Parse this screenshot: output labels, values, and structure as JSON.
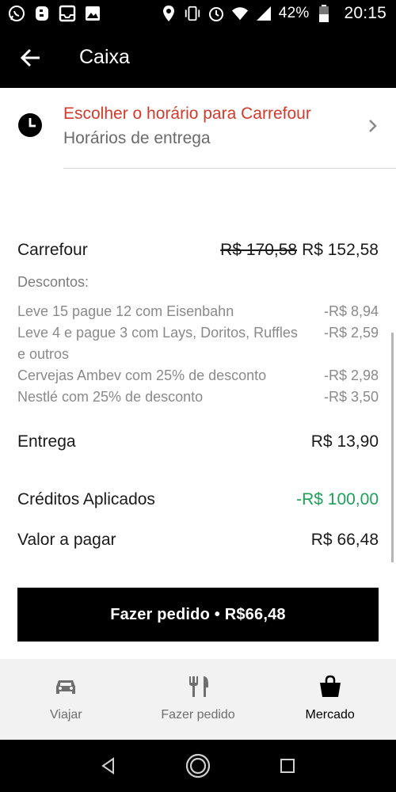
{
  "status_bar": {
    "battery": "42%",
    "time": "20:15",
    "icons_left": [
      "whatsapp-icon",
      "b-app-icon",
      "inbox-icon",
      "image-icon"
    ],
    "icons_right": [
      "location-icon",
      "vibrate-icon",
      "alarm-icon",
      "wifi-icon",
      "signal-icon",
      "battery-icon"
    ]
  },
  "app_bar": {
    "title": "Caixa"
  },
  "schedule": {
    "title": "Escolher o horário para Carrefour",
    "subtitle": "Horários de entrega"
  },
  "summary": {
    "store": "Carrefour",
    "old_price": "R$ 170,58",
    "new_price": "R$ 152,58",
    "discounts_title": "Descontos:",
    "discounts": [
      {
        "label": "Leve 15 pague 12 com Eisenbahn",
        "amount": "-R$ 8,94"
      },
      {
        "label": "Leve 4 e pague 3 com Lays, Doritos, Ruffles e outros",
        "amount": "-R$ 2,59"
      },
      {
        "label": "Cervejas Ambev com 25% de desconto",
        "amount": "-R$ 2,98"
      },
      {
        "label": "Nestlé com 25% de desconto",
        "amount": "-R$ 3,50"
      }
    ],
    "delivery_label": "Entrega",
    "delivery_amount": "R$ 13,90",
    "credits_label": "Créditos Aplicados",
    "credits_amount": "-R$ 100,00",
    "total_label": "Valor a pagar",
    "total_amount": "R$ 66,48"
  },
  "order_button": {
    "label": "Fazer pedido • R$66,48"
  },
  "tabs": [
    {
      "label": "Viajar",
      "icon": "car-icon",
      "active": false
    },
    {
      "label": "Fazer pedido",
      "icon": "fork-knife-icon",
      "active": false
    },
    {
      "label": "Mercado",
      "icon": "shopping-bag-icon",
      "active": true
    }
  ],
  "colors": {
    "accent_red": "#d13a2d",
    "credit_green": "#1fa05a",
    "bar_black": "#000000"
  }
}
